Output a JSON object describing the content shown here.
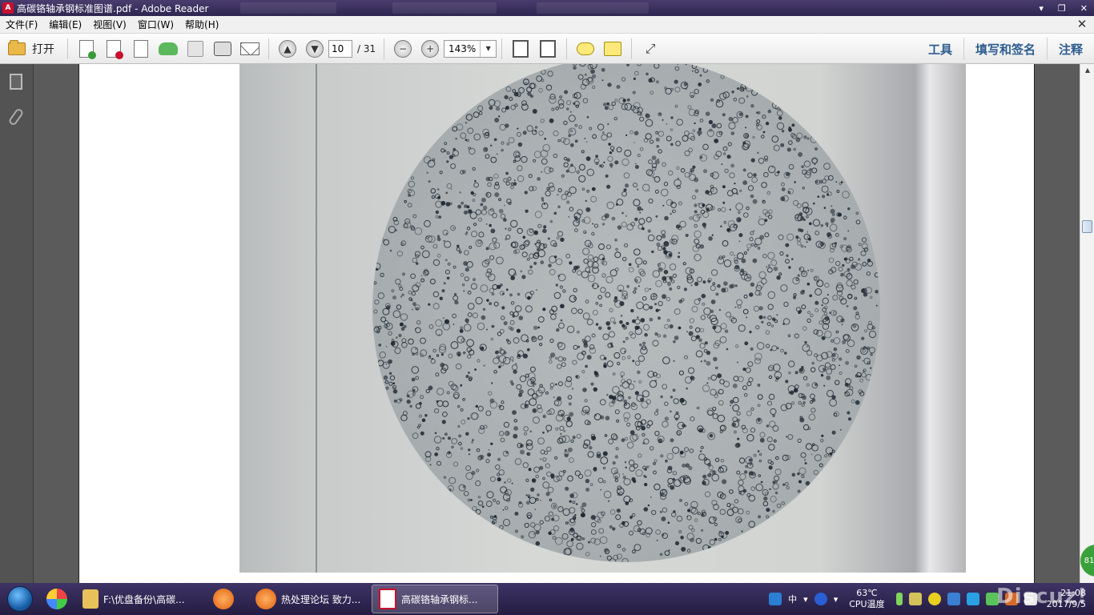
{
  "window": {
    "title": "高碳铬轴承钢标准图谱.pdf - Adobe Reader",
    "app_icon_label": "A"
  },
  "menu": {
    "items": [
      "文件(F)",
      "编辑(E)",
      "视图(V)",
      "窗口(W)",
      "帮助(H)"
    ]
  },
  "toolbar": {
    "open_label": "打开",
    "page_current": "10",
    "page_total": "/ 31",
    "zoom_value": "143%",
    "tools_label": "工具",
    "fill_sign_label": "填写和签名",
    "comment_label": "注释"
  },
  "taskbar": {
    "items": [
      {
        "label": "F:\\优盘备份\\高碳..."
      },
      {
        "label": "热处理论坛 致力..."
      },
      {
        "label": "高碳铬轴承钢标..."
      }
    ],
    "ime": "中",
    "cpu_temp": "63℃",
    "cpu_label": "CPU温度",
    "time": "21:08",
    "date": "2017/9/5",
    "watermark": "Discuz!"
  },
  "scrollbar": {
    "badge": "81"
  },
  "colors": {
    "titlebar": "#3a2f5e",
    "toolbar_link": "#2d5d90",
    "taskbar": "#2e2550"
  }
}
